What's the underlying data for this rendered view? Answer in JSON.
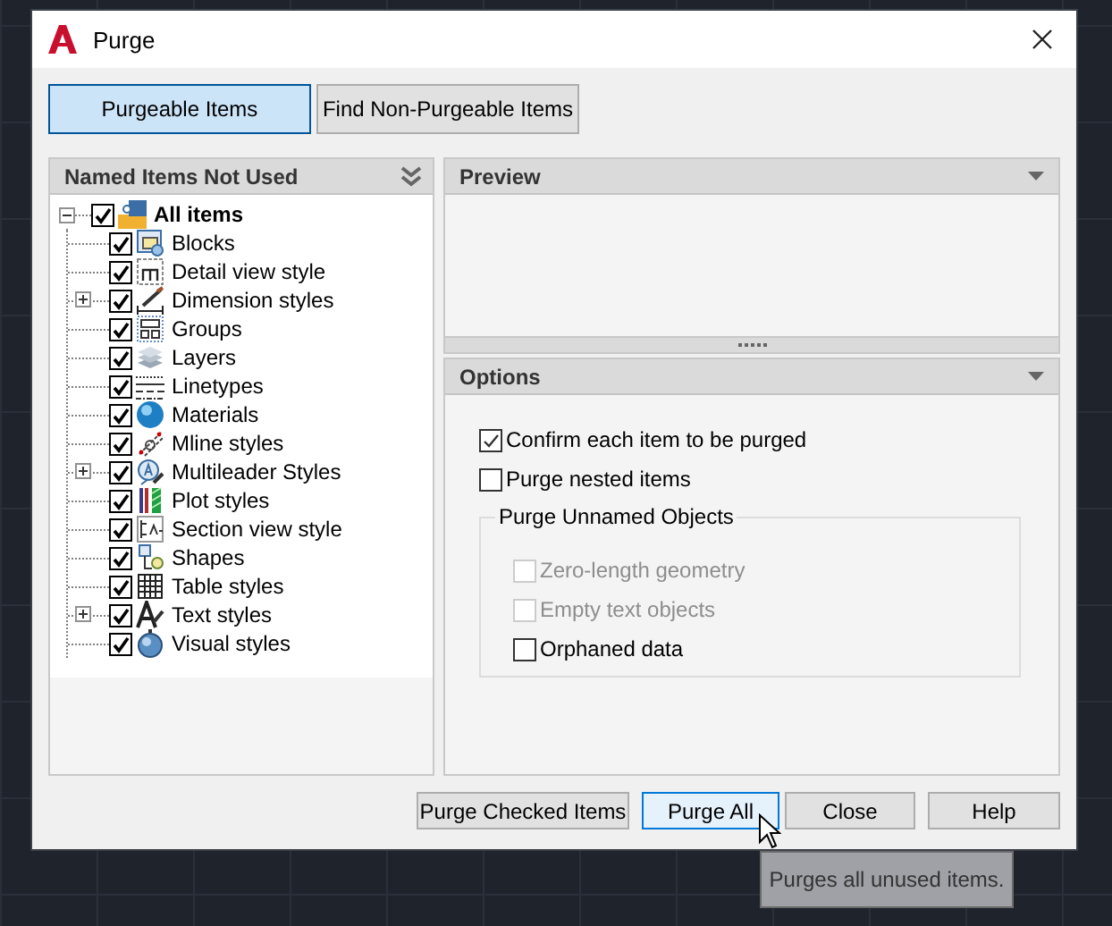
{
  "window": {
    "title": "Purge"
  },
  "tabs": [
    {
      "label": "Purgeable Items",
      "selected": true
    },
    {
      "label": "Find Non-Purgeable Items",
      "selected": false
    }
  ],
  "tree": {
    "title": "Named Items Not Used",
    "items": [
      {
        "label": "All items",
        "kind": "all",
        "checked": true,
        "expanded": true,
        "children": [
          {
            "label": "Blocks",
            "kind": "blocks",
            "checked": true,
            "collapsed": false
          },
          {
            "label": "Detail view style",
            "kind": "detail",
            "checked": true,
            "collapsed": false
          },
          {
            "label": "Dimension styles",
            "kind": "dimension",
            "checked": true,
            "collapsed": true
          },
          {
            "label": "Groups",
            "kind": "groups",
            "checked": true,
            "collapsed": false
          },
          {
            "label": "Layers",
            "kind": "layers",
            "checked": true,
            "collapsed": false
          },
          {
            "label": "Linetypes",
            "kind": "linetypes",
            "checked": true,
            "collapsed": false
          },
          {
            "label": "Materials",
            "kind": "materials",
            "checked": true,
            "collapsed": false
          },
          {
            "label": "Mline styles",
            "kind": "mline",
            "checked": true,
            "collapsed": false
          },
          {
            "label": "Multileader Styles",
            "kind": "multileader",
            "checked": true,
            "collapsed": true
          },
          {
            "label": "Plot styles",
            "kind": "plot",
            "checked": true,
            "collapsed": false
          },
          {
            "label": "Section view style",
            "kind": "section",
            "checked": true,
            "collapsed": false
          },
          {
            "label": "Shapes",
            "kind": "shapes",
            "checked": true,
            "collapsed": false
          },
          {
            "label": "Table styles",
            "kind": "table",
            "checked": true,
            "collapsed": false
          },
          {
            "label": "Text styles",
            "kind": "text",
            "checked": true,
            "collapsed": true
          },
          {
            "label": "Visual styles",
            "kind": "visual",
            "checked": true,
            "collapsed": false
          }
        ]
      }
    ]
  },
  "preview": {
    "title": "Preview"
  },
  "options": {
    "title": "Options",
    "checks": [
      {
        "label": "Confirm each item to be purged",
        "checked": true,
        "disabled": false
      },
      {
        "label": "Purge nested items",
        "checked": false,
        "disabled": false
      }
    ],
    "group": {
      "title": "Purge Unnamed Objects",
      "checks": [
        {
          "label": "Zero-length geometry",
          "checked": false,
          "disabled": true
        },
        {
          "label": "Empty text objects",
          "checked": false,
          "disabled": true
        },
        {
          "label": "Orphaned data",
          "checked": false,
          "disabled": false
        }
      ]
    }
  },
  "buttons": [
    {
      "label": "Purge Checked Items",
      "hovered": false
    },
    {
      "label": "Purge All",
      "hovered": true
    },
    {
      "label": "Close",
      "hovered": false
    },
    {
      "label": "Help",
      "hovered": false
    }
  ],
  "tooltip": "Purges all unused items."
}
